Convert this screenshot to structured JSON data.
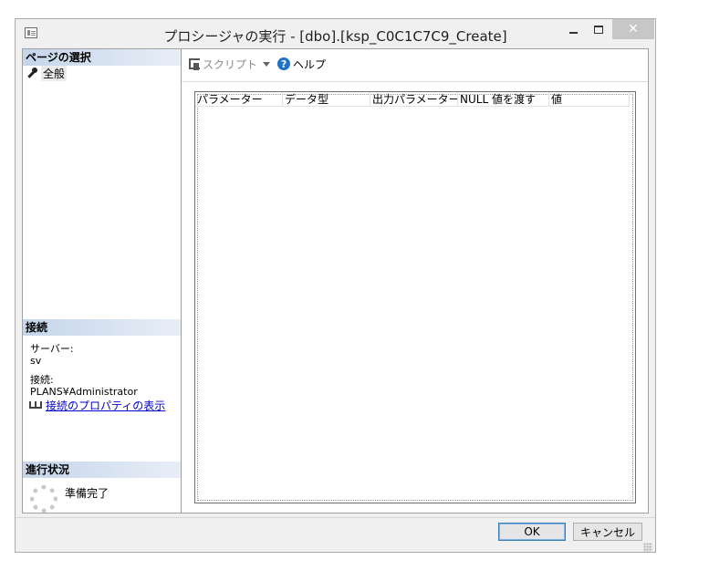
{
  "window": {
    "title": "プロシージャの実行 - [dbo].[ksp_C0C1C7C9_Create]",
    "close_symbol": "✕"
  },
  "left": {
    "page_select_header": "ページの選択",
    "page_items": [
      "全般"
    ],
    "connection_header": "接続",
    "server_label": "サーバー:",
    "server_value": "sv",
    "connection_label": "接続:",
    "connection_value": "PLANS¥Administrator",
    "connection_link": "接続のプロパティの表示",
    "progress_header": "進行状況",
    "progress_status": "準備完了"
  },
  "toolbar": {
    "script_label": "スクリプト",
    "help_label": "ヘルプ",
    "help_symbol": "?"
  },
  "grid": {
    "columns": [
      "パラメーター",
      "データ型",
      "出力パラメーター",
      "NULL 値を渡す",
      "値"
    ]
  },
  "buttons": {
    "ok": "OK",
    "cancel": "キャンセル"
  },
  "icons": [
    "app-icon",
    "wrench-icon",
    "plug-icon",
    "spinner-icon",
    "script-icon",
    "help-icon",
    "grip-icon"
  ]
}
